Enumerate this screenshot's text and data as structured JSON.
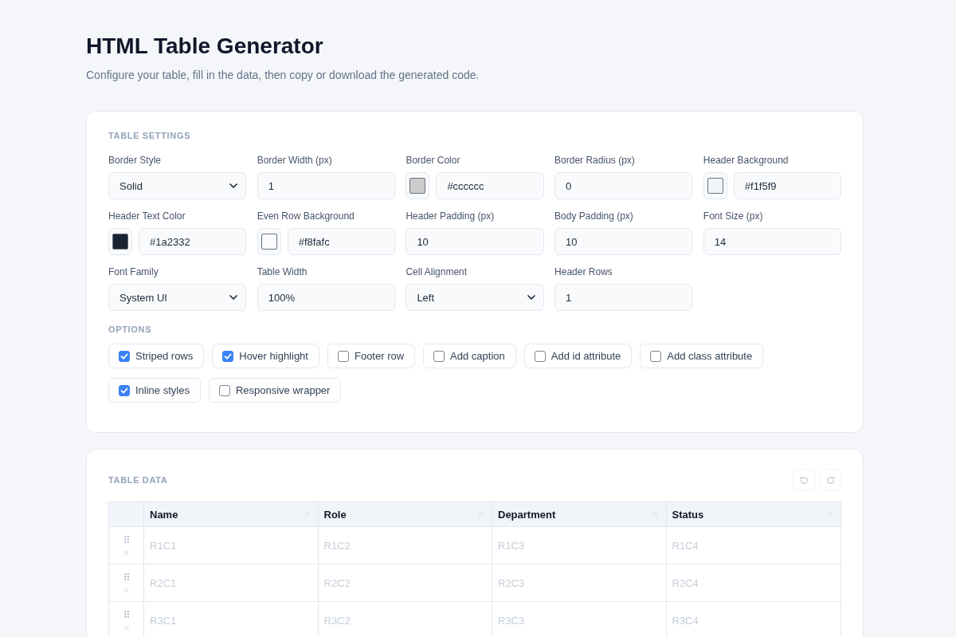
{
  "page": {
    "title": "HTML Table Generator",
    "subtitle": "Configure your table, fill in the data, then copy or download the generated code."
  },
  "settings": {
    "heading": "TABLE SETTINGS",
    "fields": [
      {
        "label": "Border Style",
        "kind": "select",
        "value": "Solid"
      },
      {
        "label": "Border Width (px)",
        "kind": "text",
        "value": "1"
      },
      {
        "label": "Border Color",
        "kind": "color",
        "value": "#cccccc",
        "color": "#cccccc"
      },
      {
        "label": "Border Radius (px)",
        "kind": "text",
        "value": "0"
      },
      {
        "label": "Header Background",
        "kind": "color",
        "value": "#f1f5f9",
        "color": "#f1f5f9"
      },
      {
        "label": "Header Text Color",
        "kind": "color",
        "value": "#1a2332",
        "color": "#1a2332"
      },
      {
        "label": "Even Row Background",
        "kind": "color",
        "value": "#f8fafc",
        "color": "#f8fafc"
      },
      {
        "label": "Header Padding (px)",
        "kind": "text",
        "value": "10"
      },
      {
        "label": "Body Padding (px)",
        "kind": "text",
        "value": "10"
      },
      {
        "label": "Font Size (px)",
        "kind": "text",
        "value": "14"
      },
      {
        "label": "Font Family",
        "kind": "select",
        "value": "System UI"
      },
      {
        "label": "Table Width",
        "kind": "text",
        "value": "100%"
      },
      {
        "label": "Cell Alignment",
        "kind": "select",
        "value": "Left"
      },
      {
        "label": "Header Rows",
        "kind": "text",
        "value": "1"
      }
    ],
    "options_heading": "OPTIONS",
    "options": [
      {
        "label": "Striped rows",
        "checked": true
      },
      {
        "label": "Hover highlight",
        "checked": true
      },
      {
        "label": "Footer row",
        "checked": false
      },
      {
        "label": "Add caption",
        "checked": false
      },
      {
        "label": "Add id attribute",
        "checked": false
      },
      {
        "label": "Add class attribute",
        "checked": false
      },
      {
        "label": "Inline styles",
        "checked": true
      },
      {
        "label": "Responsive wrapper",
        "checked": false
      }
    ]
  },
  "table_data": {
    "heading": "TABLE DATA",
    "history_buttons": [
      {
        "kind": "undo",
        "disabled": true
      },
      {
        "kind": "redo",
        "disabled": true
      }
    ],
    "columns": [
      {
        "label": "Name"
      },
      {
        "label": "Role"
      },
      {
        "label": "Department"
      },
      {
        "label": "Status"
      }
    ],
    "rows": [
      {
        "cells": [
          {
            "placeholder": "R1C1"
          },
          {
            "placeholder": "R1C2"
          },
          {
            "placeholder": "R1C3"
          },
          {
            "placeholder": "R1C4"
          }
        ]
      },
      {
        "cells": [
          {
            "placeholder": "R2C1"
          },
          {
            "placeholder": "R2C2"
          },
          {
            "placeholder": "R2C3"
          },
          {
            "placeholder": "R2C4"
          }
        ]
      },
      {
        "cells": [
          {
            "placeholder": "R3C1"
          },
          {
            "placeholder": "R3C2"
          },
          {
            "placeholder": "R3C3"
          },
          {
            "placeholder": "R3C4"
          }
        ]
      }
    ]
  }
}
